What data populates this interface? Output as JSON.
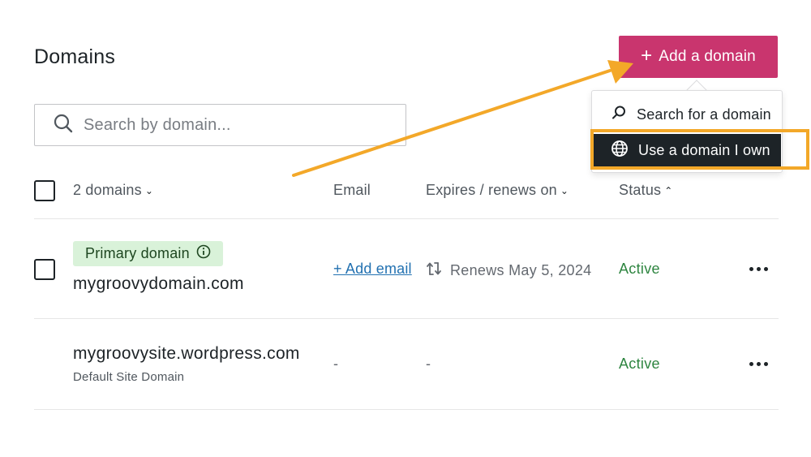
{
  "page": {
    "title": "Domains"
  },
  "add_button": {
    "label": "Add a domain",
    "color": "#c9356e"
  },
  "dropdown": {
    "items": [
      {
        "label": "Search for a domain",
        "icon": "search-icon"
      },
      {
        "label": "Use a domain I own",
        "icon": "globe-icon",
        "highlighted": true
      }
    ],
    "highlight_color": "#f3a829"
  },
  "search": {
    "placeholder": "Search by domain..."
  },
  "table": {
    "headers": {
      "domains": "2 domains",
      "email": "Email",
      "expires": "Expires / renews on",
      "status": "Status"
    },
    "rows": [
      {
        "badge": "Primary domain",
        "domain": "mygroovydomain.com",
        "email": "+ Add email",
        "renews": "Renews May 5, 2024",
        "status": "Active"
      },
      {
        "domain": "mygroovysite.wordpress.com",
        "subtitle": "Default Site Domain",
        "email": "-",
        "renews": "-",
        "status": "Active"
      }
    ]
  }
}
